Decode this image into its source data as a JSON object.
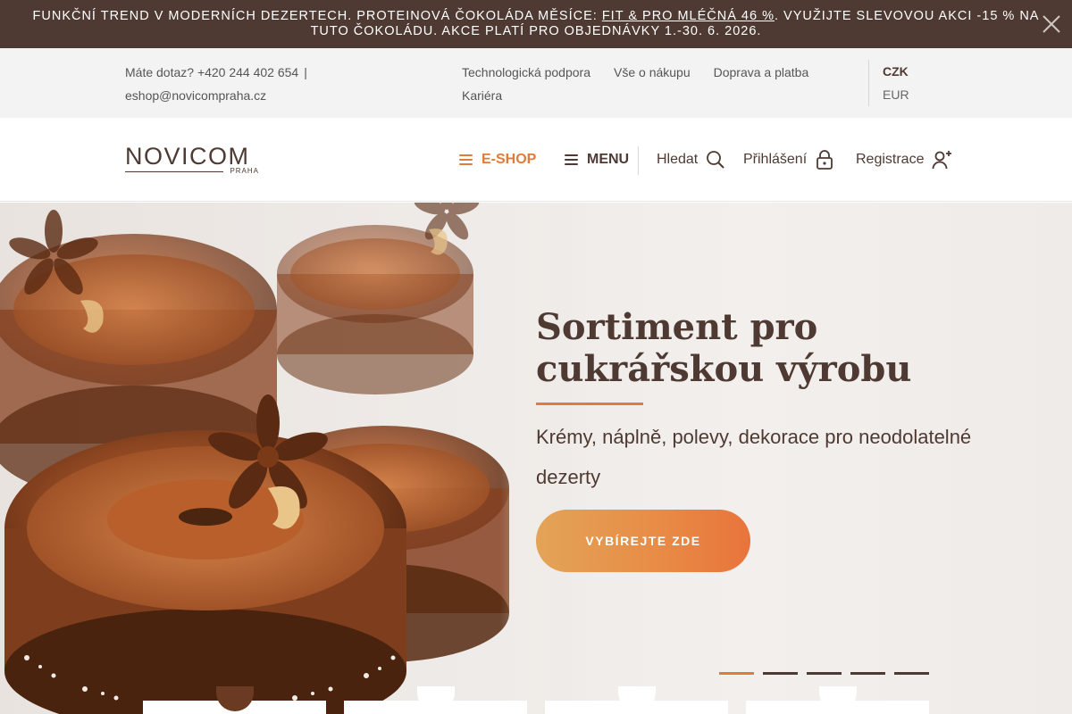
{
  "announcement": {
    "prefix": "FUNKČNÍ TREND V MODERNÍCH DEZERTECH. PROTEINOVÁ ČOKOLÁDA MĚSÍCE: ",
    "link": "FIT & PRO MLÉČNÁ 46 %",
    "suffix": ". VYUŽIJTE SLEVOVOU AKCI -15 % NA TUTO ČOKOLÁDU. AKCE PLATÍ PRO OBJEDNÁVKY 1.-30. 6. 2026.",
    "close_icon": "close-icon"
  },
  "topbar": {
    "phone_text": "Máte dotaz? +420 244 402 654",
    "separator": "|",
    "email": "eshop@novicompraha.cz",
    "links": [
      "Technologická podpora",
      "Vše o nákupu",
      "Doprava a platba",
      "Kariéra"
    ],
    "currencies": [
      "CZK",
      "EUR"
    ],
    "active_currency": "CZK"
  },
  "header": {
    "logo_text": "NOVICOM",
    "logo_sub": "PRAHA",
    "eshop_label": "E-SHOP",
    "menu_label": "MENU",
    "search_label": "Hledat",
    "login_label": "Přihlášení",
    "register_label": "Registrace"
  },
  "hero": {
    "title": "Sortiment pro cukrářskou výrobu",
    "subtitle": "Krémy, náplně, polevy, dekorace pro neodolatelné dezerty",
    "cta": "VYBÍREJTE ZDE",
    "slides_count": 5,
    "active_slide": 1
  },
  "colors": {
    "brand_brown": "#4e3a32",
    "accent_orange": "#e07b39",
    "topbar_bg": "#f3f3f3"
  }
}
